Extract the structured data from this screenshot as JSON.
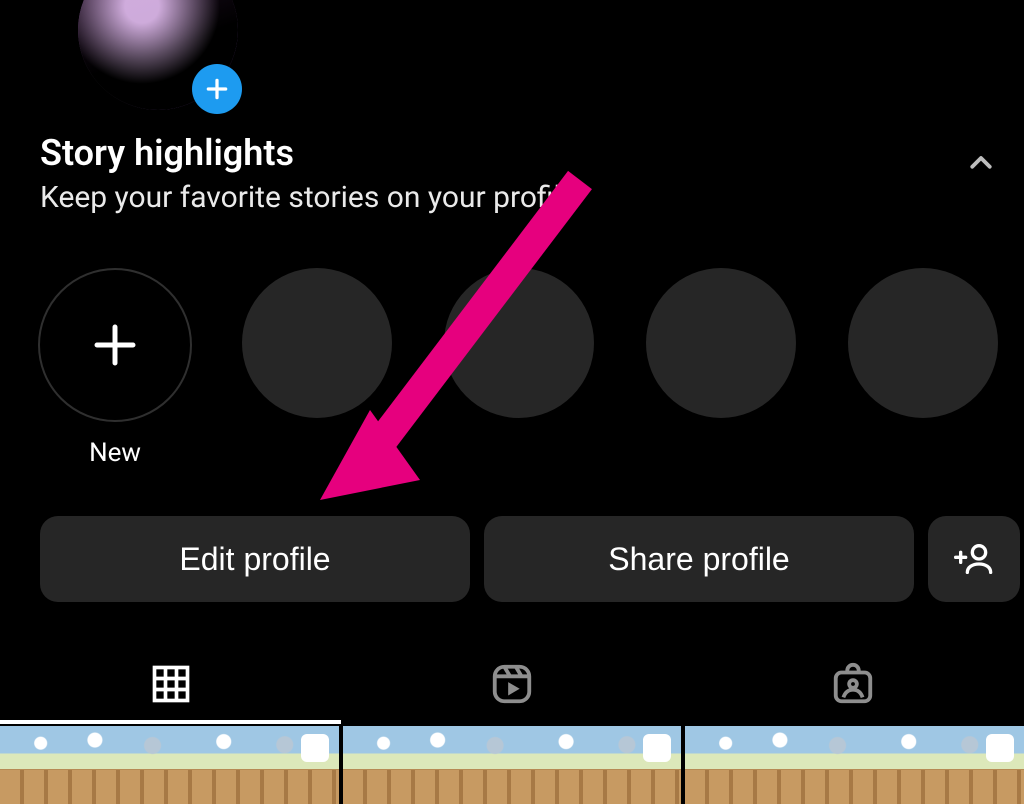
{
  "highlights": {
    "title": "Story highlights",
    "subtitle": "Keep your favorite stories on your profile",
    "new_label": "New"
  },
  "buttons": {
    "edit": "Edit profile",
    "share": "Share profile"
  },
  "annotation": {
    "arrow_color": "#e6007e"
  }
}
